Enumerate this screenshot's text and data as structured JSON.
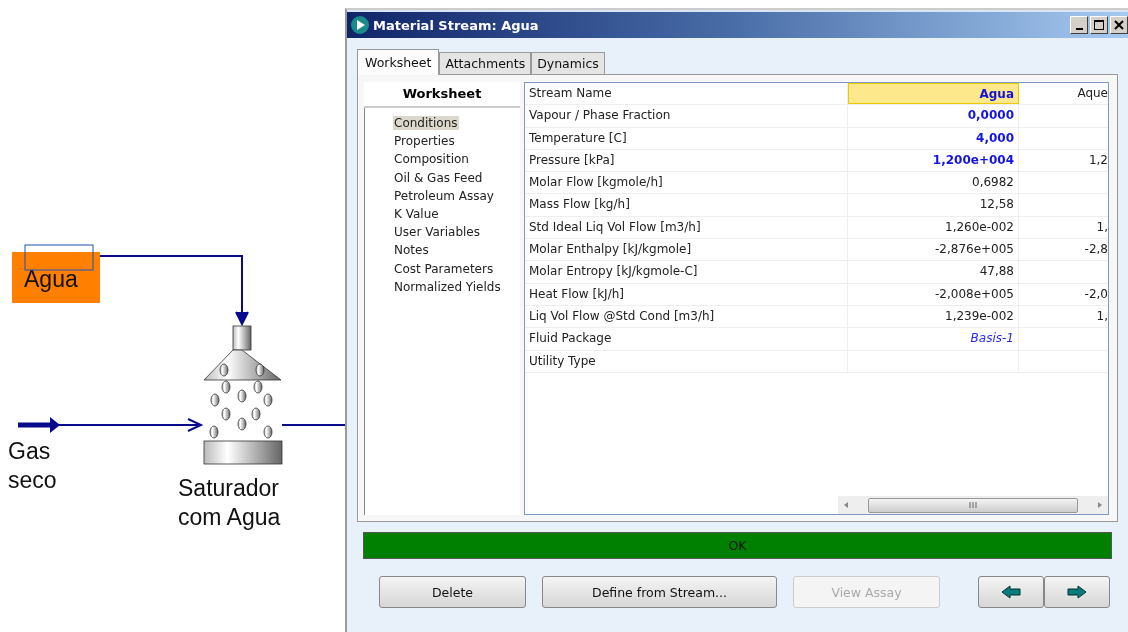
{
  "flowsheet": {
    "feed": {
      "name": "Agua"
    },
    "gas": {
      "name": "Gas seco"
    },
    "unit": {
      "name": "Saturador com Agua"
    }
  },
  "window": {
    "title": "Material Stream: Agua"
  },
  "tabs": [
    {
      "label": "Worksheet",
      "selected": true
    },
    {
      "label": "Attachments",
      "selected": false
    },
    {
      "label": "Dynamics",
      "selected": false
    }
  ],
  "nav": {
    "title": "Worksheet",
    "items": [
      {
        "label": "Conditions",
        "selected": true
      },
      {
        "label": "Properties",
        "selected": false
      },
      {
        "label": "Composition",
        "selected": false
      },
      {
        "label": "Oil & Gas Feed",
        "selected": false
      },
      {
        "label": "Petroleum Assay",
        "selected": false
      },
      {
        "label": "K Value",
        "selected": false
      },
      {
        "label": "User Variables",
        "selected": false
      },
      {
        "label": "Notes",
        "selected": false
      },
      {
        "label": "Cost Parameters",
        "selected": false
      },
      {
        "label": "Normalized Yields",
        "selected": false
      }
    ]
  },
  "table": {
    "header": {
      "label": "Stream Name",
      "columns": [
        {
          "text": "Agua",
          "selected": true
        },
        {
          "text": "Aque",
          "selected": false
        }
      ]
    },
    "rows": [
      {
        "label": "Vapour / Phase Fraction",
        "value": "0,0000",
        "kind": "specified"
      },
      {
        "label": "Temperature [C]",
        "value": "4,000",
        "kind": "specified"
      },
      {
        "label": "Pressure [kPa]",
        "value": "1,200e+004",
        "kind": "specified",
        "column_3": "1,2"
      },
      {
        "label": "Molar Flow [kgmole/h]",
        "value": "0,6982",
        "kind": "calculated"
      },
      {
        "label": "Mass Flow [kg/h]",
        "value": "12,58",
        "kind": "calculated"
      },
      {
        "label": "Std Ideal Liq Vol Flow [m3/h]",
        "value": "1,260e-002",
        "kind": "calculated",
        "column_3": "1,"
      },
      {
        "label": "Molar Enthalpy [kJ/kgmole]",
        "value": "-2,876e+005",
        "kind": "calculated",
        "column_3": "-2,8"
      },
      {
        "label": "Molar Entropy [kJ/kgmole-C]",
        "value": "47,88",
        "kind": "calculated"
      },
      {
        "label": "Heat Flow [kJ/h]",
        "value": "-2,008e+005",
        "kind": "calculated",
        "column_3": "-2,0"
      },
      {
        "label": "Liq Vol Flow @Std Cond [m3/h]",
        "value": "1,239e-002",
        "kind": "calculated",
        "column_3": "1,"
      },
      {
        "label": "Fluid Package",
        "value": "Basis-1",
        "kind": "link"
      },
      {
        "label": "Utility Type",
        "kind": "calculated"
      }
    ]
  },
  "status": {
    "text": "OK"
  },
  "buttons": [
    {
      "label": "Delete",
      "disabled": false
    },
    {
      "label": "Define from Stream...",
      "disabled": false
    },
    {
      "label": "View Assay",
      "disabled": true
    }
  ]
}
